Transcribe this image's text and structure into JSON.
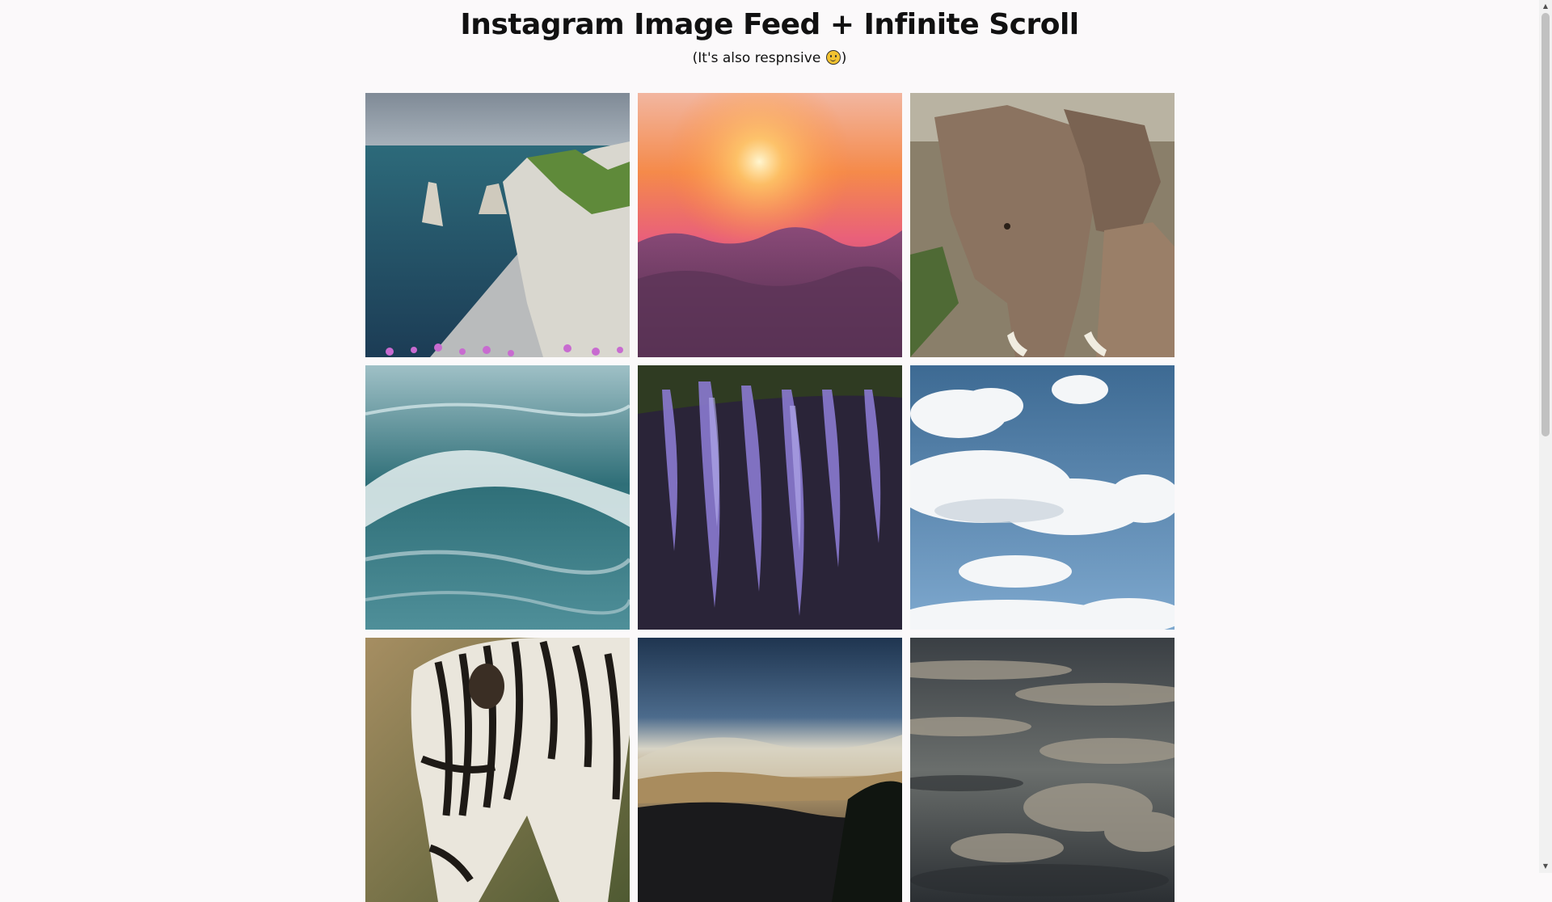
{
  "header": {
    "title": "Instagram Image Feed + Infinite Scroll",
    "subtitle_before": "(It's also respnsive ",
    "subtitle_after": ")"
  },
  "feed": {
    "images": [
      {
        "subject": "cliffs-sea"
      },
      {
        "subject": "sunset-clouds"
      },
      {
        "subject": "elephant"
      },
      {
        "subject": "ocean-wave"
      },
      {
        "subject": "wisteria"
      },
      {
        "subject": "blue-sky-clouds"
      },
      {
        "subject": "zebra"
      },
      {
        "subject": "mountain-landscape"
      },
      {
        "subject": "dark-clouds"
      }
    ]
  },
  "colors": {
    "background": "#fbf9fa",
    "scrollbar_thumb": "#c1c1c1"
  },
  "icons": {
    "emoji": "smiley-icon",
    "scroll_up": "scroll-up-arrow-icon",
    "scroll_down": "scroll-down-arrow-icon"
  }
}
